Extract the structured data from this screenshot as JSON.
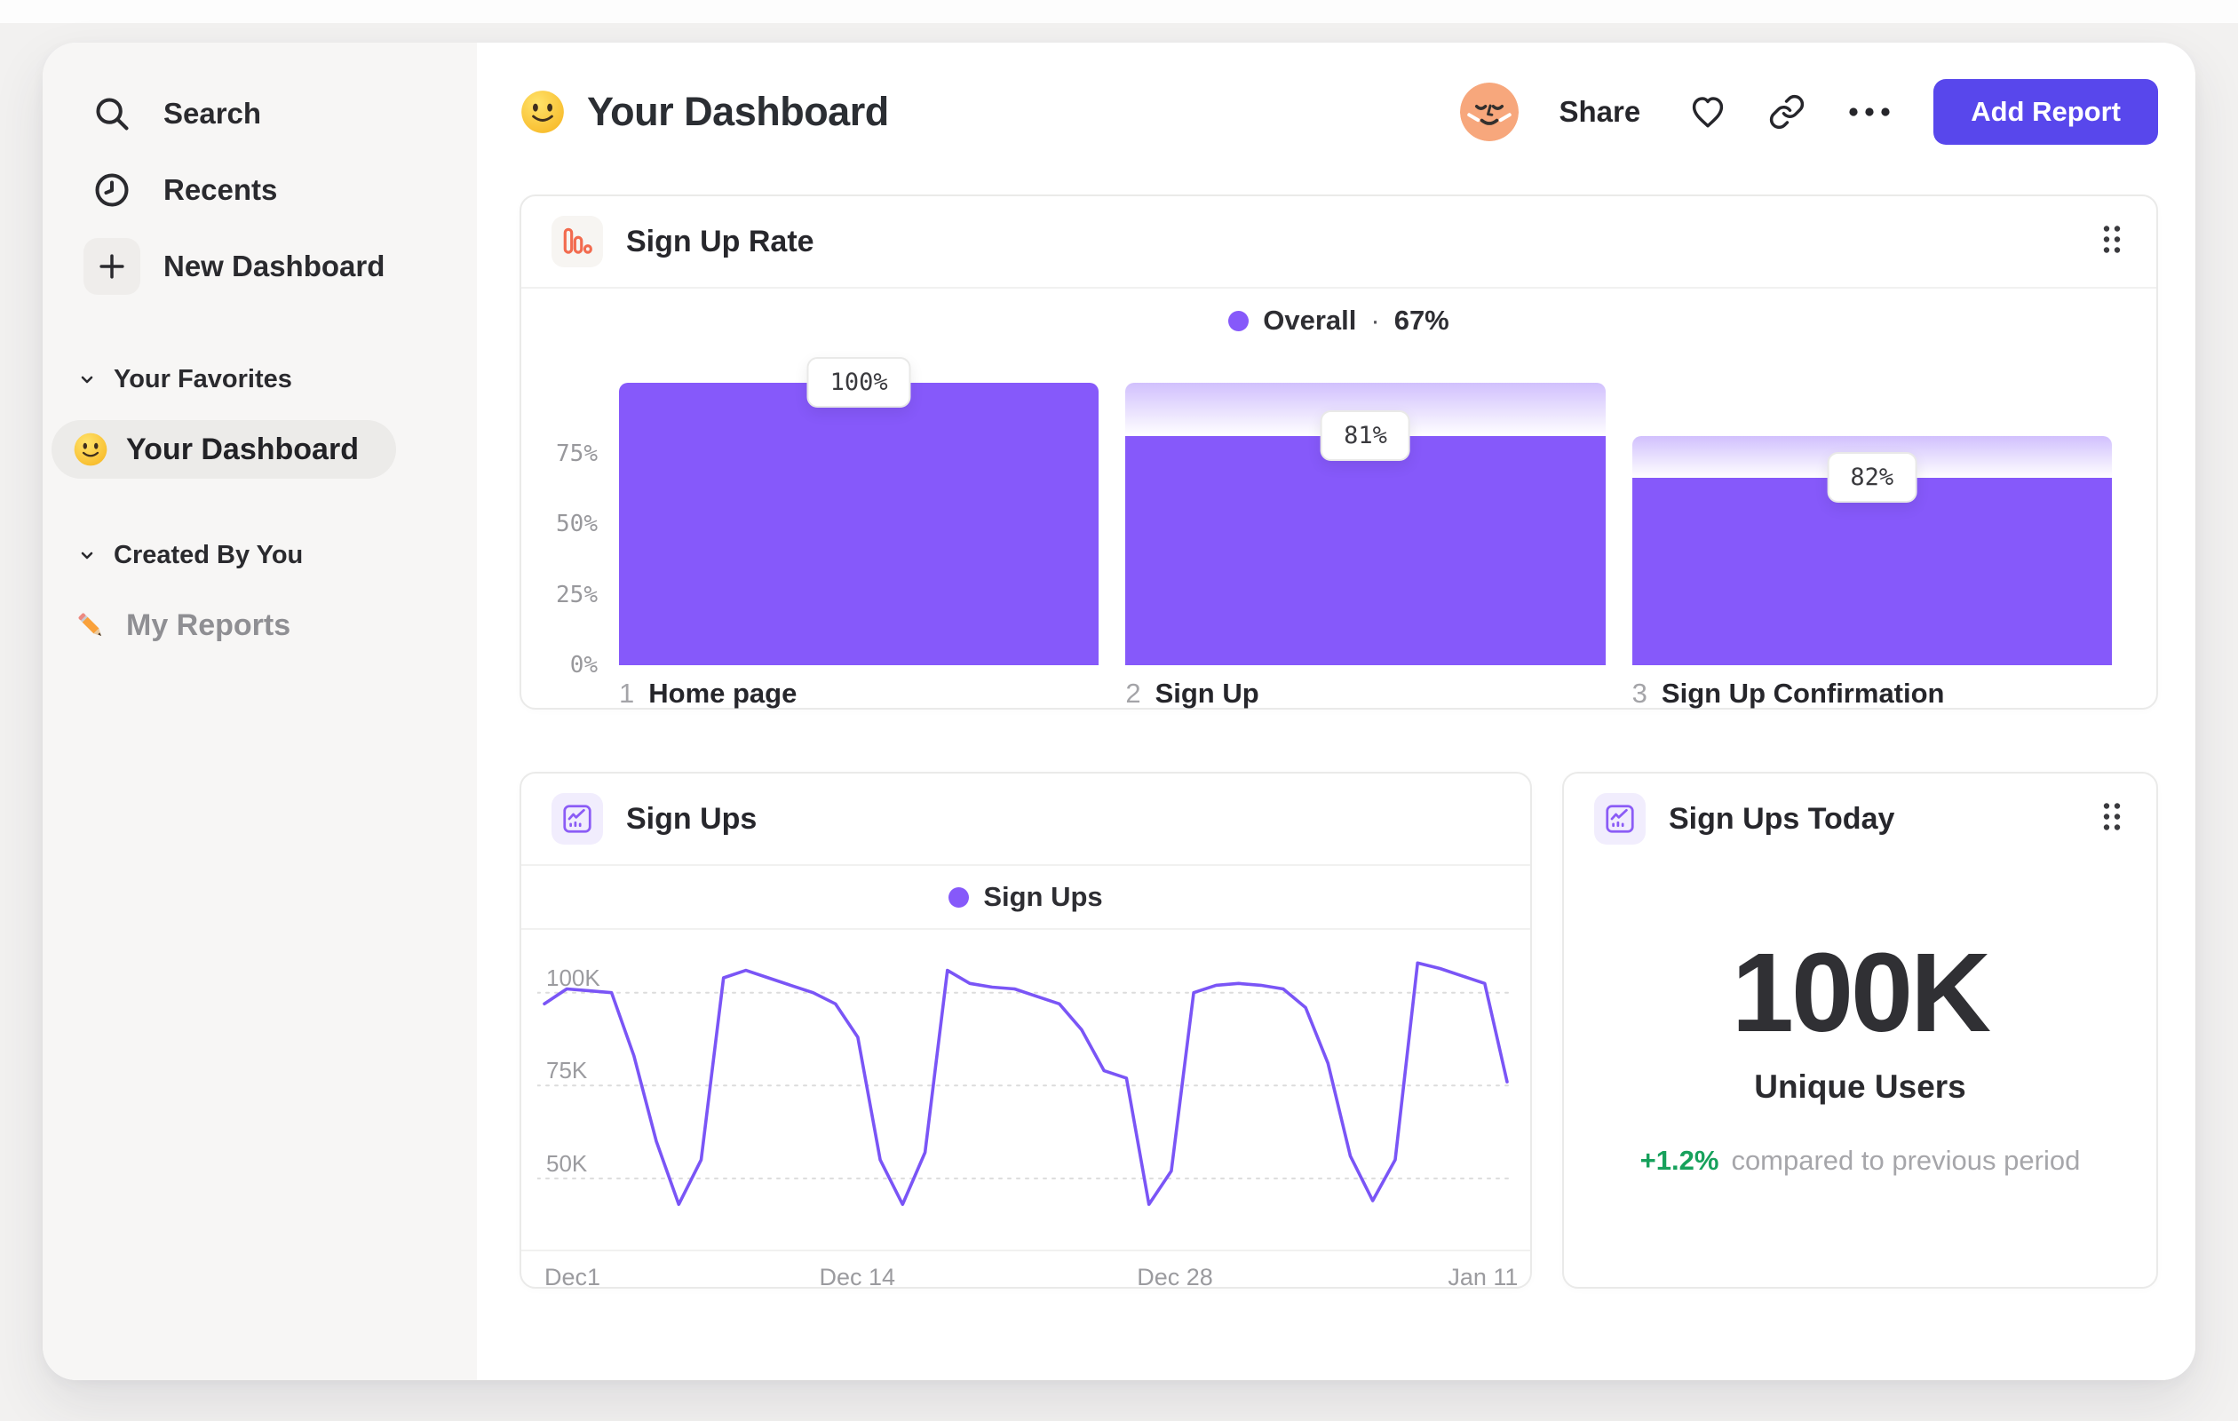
{
  "sidebar": {
    "nav": [
      {
        "label": "Search"
      },
      {
        "label": "Recents"
      },
      {
        "label": "New Dashboard"
      }
    ],
    "sections": [
      {
        "title": "Your Favorites",
        "item": {
          "label": "Your Dashboard"
        }
      },
      {
        "title": "Created By You",
        "item": {
          "label": "My Reports"
        }
      }
    ]
  },
  "header": {
    "title": "Your Dashboard",
    "share": "Share",
    "add_report": "Add Report"
  },
  "funnel_card": {
    "title": "Sign Up Rate",
    "legend_label": "Overall",
    "legend_sep": "·",
    "legend_value": "67%",
    "y_ticks": [
      {
        "label": "75%",
        "value": 75
      },
      {
        "label": "50%",
        "value": 50
      },
      {
        "label": "25%",
        "value": 25
      },
      {
        "label": "0%",
        "value": 0
      }
    ],
    "steps": [
      {
        "num": "1",
        "label": "Home page",
        "tooltip": "100%",
        "top_pct": 100,
        "solid_pct": 100
      },
      {
        "num": "2",
        "label": "Sign Up",
        "tooltip": "81%",
        "top_pct": 100,
        "solid_pct": 81
      },
      {
        "num": "3",
        "label": "Sign Up Confirmation",
        "tooltip": "82%",
        "top_pct": 81,
        "solid_pct": 66.4
      }
    ],
    "bar_color": "#8659FA"
  },
  "line_card": {
    "title": "Sign Ups",
    "legend": "Sign Ups",
    "y_gridlines": [
      {
        "label": "100K",
        "value": 100
      },
      {
        "label": "75K",
        "value": 75
      },
      {
        "label": "50K",
        "value": 50
      }
    ],
    "x_ticks": [
      {
        "label": "Dec1",
        "pos": 0
      },
      {
        "label": "Dec 14",
        "pos": 0.325
      },
      {
        "label": "Dec 28",
        "pos": 0.655
      },
      {
        "label": "Jan 11",
        "pos": 0.975
      }
    ],
    "line_color": "#7A55F6"
  },
  "kpi_card": {
    "title": "Sign Ups Today",
    "value": "100K",
    "unit_label": "Unique Users",
    "delta": "+1.2%",
    "delta_note": "compared to previous period",
    "delta_color": "#17A15C"
  },
  "chart_data": [
    {
      "type": "bar",
      "title": "Sign Up Rate",
      "categories": [
        "1 Home page",
        "2 Sign Up",
        "3 Sign Up Confirmation"
      ],
      "values": [
        100,
        81,
        82
      ],
      "cumulative_pct": [
        100,
        81,
        66.4
      ],
      "legend": "Overall · 67%",
      "ylim": [
        0,
        100
      ],
      "y_tick_labels": [
        "0%",
        "25%",
        "50%",
        "75%"
      ],
      "grid": false,
      "legend_position": "top-center"
    },
    {
      "type": "line",
      "title": "Sign Ups",
      "legend": "Sign Ups",
      "x_tick_labels": [
        "Dec1",
        "Dec 14",
        "Dec 28",
        "Jan 11"
      ],
      "y_tick_labels": [
        "50K",
        "75K",
        "100K"
      ],
      "unit": "thousands of sign ups per day",
      "ylim_plot": [
        33.7,
        115
      ],
      "values": [
        97,
        101,
        100.5,
        100,
        83,
        60,
        43,
        55,
        104,
        106,
        104,
        102,
        100,
        97,
        88,
        55,
        43,
        57,
        106,
        102.5,
        101.5,
        101,
        99,
        97,
        90,
        79,
        77,
        43,
        52,
        100,
        102,
        102.5,
        102,
        101,
        96,
        81,
        56,
        44,
        55,
        108,
        106.5,
        104.5,
        102.5,
        76
      ],
      "grid": "dashed-horizontal",
      "legend_position": "top-center"
    },
    {
      "type": "kpi",
      "title": "Sign Ups Today",
      "value": "100K",
      "label": "Unique Users",
      "delta": "+1.2%",
      "note": "compared to previous period"
    }
  ]
}
